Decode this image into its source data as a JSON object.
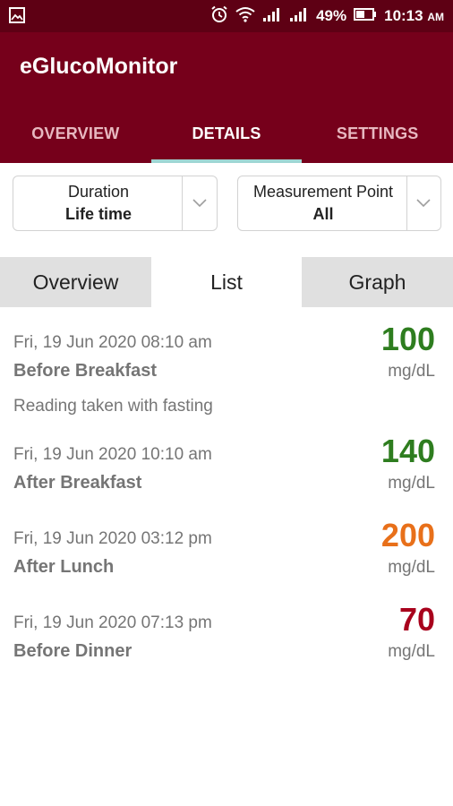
{
  "status_bar": {
    "battery": "49%",
    "time": "10:13",
    "ampm": "AM"
  },
  "app": {
    "title": "eGlucoMonitor"
  },
  "tabs": [
    {
      "label": "OVERVIEW",
      "active": false
    },
    {
      "label": "DETAILS",
      "active": true
    },
    {
      "label": "SETTINGS",
      "active": false
    }
  ],
  "filters": {
    "duration": {
      "label": "Duration",
      "value": "Life time"
    },
    "measurement_point": {
      "label": "Measurement Point",
      "value": "All"
    }
  },
  "subtabs": [
    {
      "label": "Overview",
      "active": false
    },
    {
      "label": "List",
      "active": true
    },
    {
      "label": "Graph",
      "active": false
    }
  ],
  "readings": [
    {
      "datetime": "Fri, 19 Jun 2020 08:10 am",
      "point": "Before Breakfast",
      "note": "Reading taken with fasting",
      "value": "100",
      "unit": "mg/dL",
      "color": "#2e7d1f"
    },
    {
      "datetime": "Fri, 19 Jun 2020 10:10 am",
      "point": "After Breakfast",
      "note": "",
      "value": "140",
      "unit": "mg/dL",
      "color": "#2e7d1f"
    },
    {
      "datetime": "Fri, 19 Jun 2020 03:12 pm",
      "point": "After Lunch",
      "note": "",
      "value": "200",
      "unit": "mg/dL",
      "color": "#e8701a"
    },
    {
      "datetime": "Fri, 19 Jun 2020 07:13 pm",
      "point": "Before Dinner",
      "note": "",
      "value": "70",
      "unit": "mg/dL",
      "color": "#a8001c"
    }
  ],
  "colors": {
    "brand": "#76001b",
    "status_bar": "#5e0014",
    "tab_indicator": "#9fd6d4"
  }
}
